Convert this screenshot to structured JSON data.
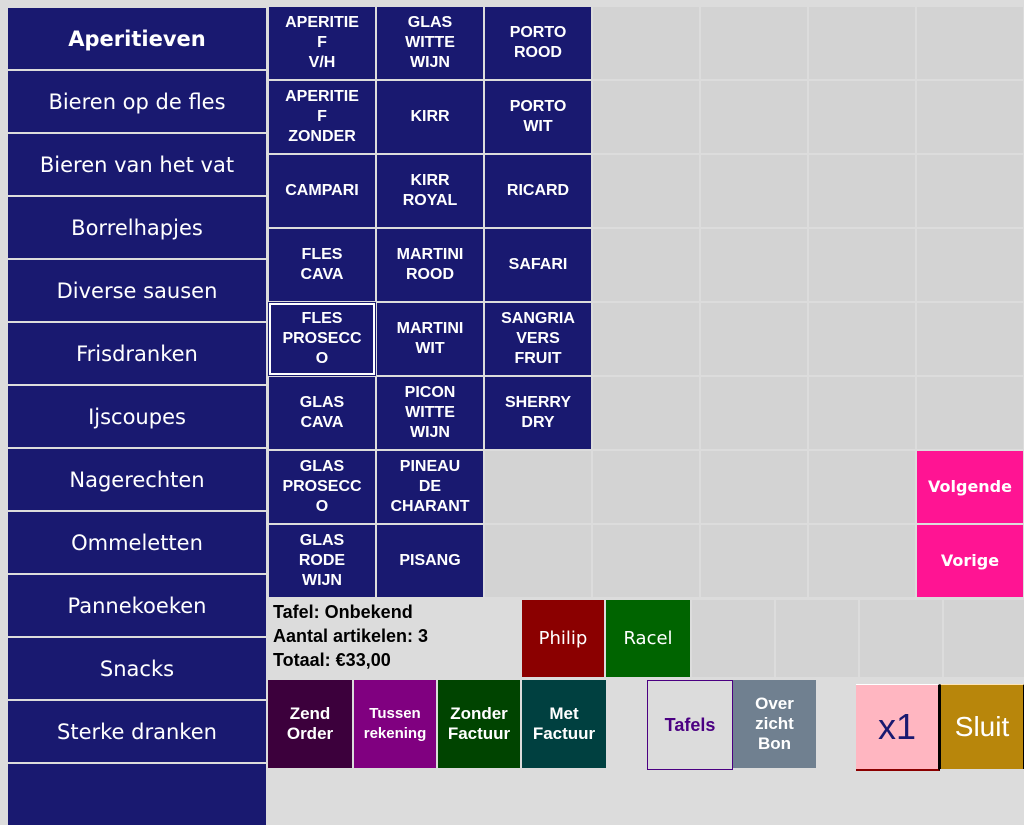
{
  "sidebar": {
    "categories": [
      {
        "label": "Aperitieven",
        "active": true
      },
      {
        "label": "Bieren op de fles"
      },
      {
        "label": "Bieren van het vat"
      },
      {
        "label": "Borrelhapjes"
      },
      {
        "label": "Diverse sausen"
      },
      {
        "label": "Frisdranken"
      },
      {
        "label": "Ijscoupes"
      },
      {
        "label": "Nagerechten"
      },
      {
        "label": "Ommeletten"
      },
      {
        "label": "Pannekoeken"
      },
      {
        "label": "Snacks"
      },
      {
        "label": "Sterke dranken"
      }
    ]
  },
  "products": {
    "columns": [
      [
        "APERITIE\nF\nV/H",
        "APERITIE\nF\nZONDER",
        "CAMPARI",
        "FLES\nCAVA",
        "FLES\nPROSECC\nO",
        "GLAS\nCAVA",
        "GLAS\nPROSECC\nO",
        "GLAS\nRODE\nWIJN"
      ],
      [
        "GLAS\nWITTE\nWIJN",
        "KIRR",
        "KIRR\nROYAL",
        "MARTINI\nROOD",
        "MARTINI\nWIT",
        "PICON\nWITTE\nWIJN",
        "PINEAU\nDE\nCHARANT",
        "PISANG"
      ],
      [
        "PORTO\nROOD",
        "PORTO\nWIT",
        "RICARD",
        "SAFARI",
        "SANGRIA\nVERS\nFRUIT",
        "SHERRY\nDRY"
      ]
    ],
    "selected": "FLES\nPROSECC\nO"
  },
  "paging": {
    "next_label": "Volgende",
    "prev_label": "Vorige"
  },
  "order_info": {
    "table": "Tafel: Onbekend",
    "item_count": "Aantal artikelen: 3",
    "total": "Totaal: €33,00"
  },
  "users": [
    {
      "label": "Philip",
      "color": "#8b0000"
    },
    {
      "label": "Racel",
      "color": "#006400"
    }
  ],
  "actions": {
    "send_order": "Zend\nOrder",
    "interim_bill": "Tussen\nrekening",
    "no_invoice": "Zonder\nFactuur",
    "with_invoice": "Met\nFactuur",
    "tables": "Tafels",
    "overview": "Over\nzicht\nBon",
    "multiplier": "x1",
    "close": "Sluit"
  },
  "colors": {
    "category_bg": "#191970",
    "empty_cell": "#d3d3d3",
    "nav_button": "#ff1493",
    "send_order": "#3c003c",
    "interim_bill": "#800080",
    "no_invoice": "#004400",
    "with_invoice": "#004040",
    "overview": "#708090",
    "multiplier_bg": "#ffb6c1",
    "close_bg": "#b8860b"
  }
}
